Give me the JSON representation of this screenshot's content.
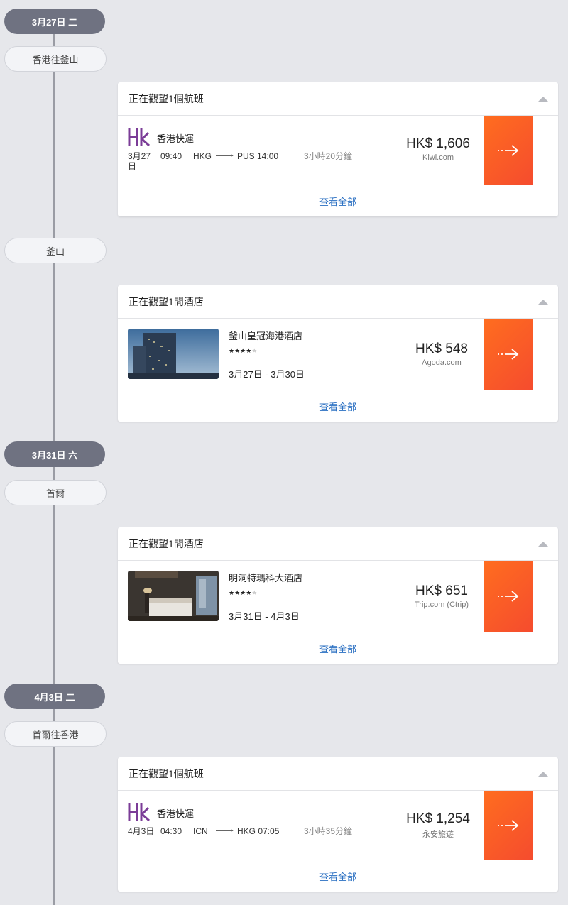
{
  "timeline": [
    {
      "date": "3月27日 二",
      "place": "香港往釜山"
    },
    {
      "place": "釜山"
    },
    {
      "date": "3月31日 六",
      "place": "首爾"
    },
    {
      "date": "4月3日 二",
      "place": "首爾往香港"
    }
  ],
  "cards": [
    {
      "header": "正在觀望1個航班",
      "airline": "香港快運",
      "date": "3月27日",
      "depart_time": "09:40",
      "from": "HKG",
      "to": "PUS 14:00",
      "duration": "3小時20分鐘",
      "price": "HK$ 1,606",
      "provider": "Kiwi.com",
      "footer": "查看全部"
    },
    {
      "header": "正在觀望1間酒店",
      "hotel": "釜山皇冠海港酒店",
      "stars": "★★★★",
      "stars_dim": "★",
      "dates": "3月27日 - 3月30日",
      "price": "HK$ 548",
      "provider": "Agoda.com",
      "footer": "查看全部"
    },
    {
      "header": "正在觀望1間酒店",
      "hotel": "明洞特瑪科大酒店",
      "stars": "★★★★",
      "stars_dim": "★",
      "dates": "3月31日 - 4月3日",
      "price": "HK$ 651",
      "provider": "Trip.com (Ctrip)",
      "footer": "查看全部"
    },
    {
      "header": "正在觀望1個航班",
      "airline": "香港快運",
      "date": "4月3日",
      "depart_time": "04:30",
      "from": "ICN",
      "to": "HKG 07:05",
      "duration": "3小時35分鐘",
      "price": "HK$ 1,254",
      "provider": "永安旅遊",
      "footer": "查看全部"
    }
  ],
  "colors": {
    "accent": "#f55a28",
    "link": "#2a6fc2",
    "airline_logo": "#7b3c97"
  },
  "icons": {
    "arrow": "arrow-right-icon",
    "collapse": "chevron-up-icon",
    "logo": "hk-express-logo"
  }
}
